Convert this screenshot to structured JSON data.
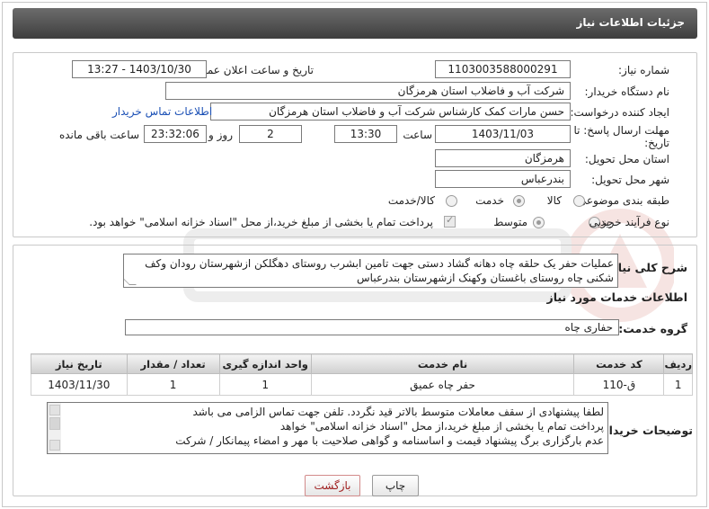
{
  "header": {
    "title": "جزئیات اطلاعات نیاز"
  },
  "labels": {
    "need_number": "شماره نیاز:",
    "announce_datetime": "تاریخ و ساعت اعلان عمومی:",
    "buyer_org": "نام دستگاه خریدار:",
    "requester": "ایجاد کننده درخواست:",
    "deadline_line1": "مهلت ارسال پاسخ: تا",
    "deadline_line2": "تاریخ:",
    "time_word": "ساعت",
    "day_and": "روز و",
    "remaining": "ساعت باقی مانده",
    "delivery_province": "استان محل تحویل:",
    "delivery_city": "شهر محل تحویل:",
    "category": "طبقه بندی موضوعی:",
    "process_type": "نوع فرآیند خرید :",
    "general_desc": "شرح کلی نیاز:",
    "services_info": "اطلاعات خدمات مورد نیاز",
    "service_group": "گروه خدمت:",
    "buyer_notes": "توضیحات خریدار:"
  },
  "fields": {
    "need_number": "1103003588000291",
    "announce_datetime": "1403/10/30 - 13:27",
    "buyer_org": "شرکت آب و فاضلاب استان هرمزگان",
    "requester": "حسن مارات کمک کارشناس شرکت آب و فاضلاب استان هرمزگان",
    "deadline_date": "1403/11/03",
    "deadline_time": "13:30",
    "days": "2",
    "remaining_time": "23:32:06",
    "delivery_province": "هرمزگان",
    "delivery_city": "بندرعباس",
    "general_desc": "عملیات حفر یک حلقه چاه دهانه گشاد دستی جهت تامین ابشرب روستای دهگلکن ازشهرستان رودان وکف شکنی چاه روستای باغستان وکهنک ازشهرستان بندرعباس",
    "service_group": "حفاری چاه"
  },
  "links": {
    "buyer_contact": "اطلاعات تماس خریدار"
  },
  "category_options": [
    {
      "label": "کالا",
      "selected": false
    },
    {
      "label": "خدمت",
      "selected": true
    },
    {
      "label": "کالا/خدمت",
      "selected": false
    }
  ],
  "process_options": [
    {
      "label": "جزیی",
      "selected": false
    },
    {
      "label": "متوسط",
      "selected": true
    }
  ],
  "payment_note": "پرداخت تمام یا بخشی از مبلغ خرید،از محل \"اسناد خزانه اسلامی\" خواهد بود.",
  "table": {
    "headers": [
      "ردیف",
      "کد خدمت",
      "نام خدمت",
      "واحد اندازه گیری",
      "تعداد / مقدار",
      "تاریخ نیاز"
    ],
    "rows": [
      [
        "1",
        "ق-110",
        "حفر چاه عمیق",
        "1",
        "1",
        "1403/11/30"
      ]
    ]
  },
  "buyer_notes_lines": [
    "لطفا پیشنهادی از سقف معاملات متوسط بالاتر قید نگردد. تلفن جهت تماس الزامی می باشد",
    "پرداخت تمام یا بخشی از مبلغ خرید،از محل \"اسناد خزانه اسلامی\" خواهد",
    "عدم بارگزاری برگ پیشنهاد قیمت و اساسنامه و گواهی صلاحیت با مهر و امضاء پیمانکار / شرکت"
  ],
  "buttons": {
    "print": "چاپ",
    "back": "بازگشت"
  },
  "colors": {
    "header_bg": "#4a4a4a",
    "link": "#1a4fb5",
    "watermark": "#c0392b"
  }
}
